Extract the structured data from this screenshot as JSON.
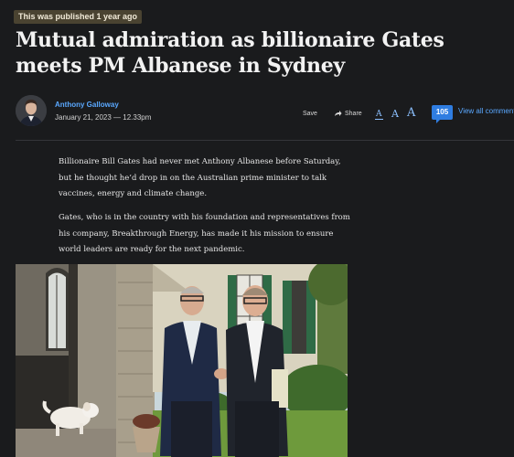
{
  "article": {
    "badge": "This was published 1 year ago",
    "headline": "Mutual admiration as billionaire Gates meets PM Albanese in Sydney",
    "author": "Anthony Galloway",
    "date": "January 21, 2023 — 12.33pm",
    "paragraphs": [
      "Billionaire Bill Gates had never met Anthony Albanese before Saturday, but he thought he’d drop in on the Australian prime minister to talk vaccines, energy and climate change.",
      "Gates, who is in the country with his foundation and representatives from his company, Breakthrough Energy, has made it his mission to ensure world leaders are ready for the next pandemic."
    ]
  },
  "toolbar": {
    "save_label": "Save",
    "share_label": "Share",
    "font_small": "A",
    "font_medium": "A",
    "font_large": "A",
    "comment_count": "105",
    "comments_label": "View all comments"
  },
  "icons": {
    "share": "share-arrow-icon",
    "comment": "comment-bubble-icon"
  },
  "colors": {
    "background": "#1a1b1d",
    "link": "#5aa8ff",
    "accent": "#2f7de1",
    "badge_bg": "#4a4331"
  }
}
